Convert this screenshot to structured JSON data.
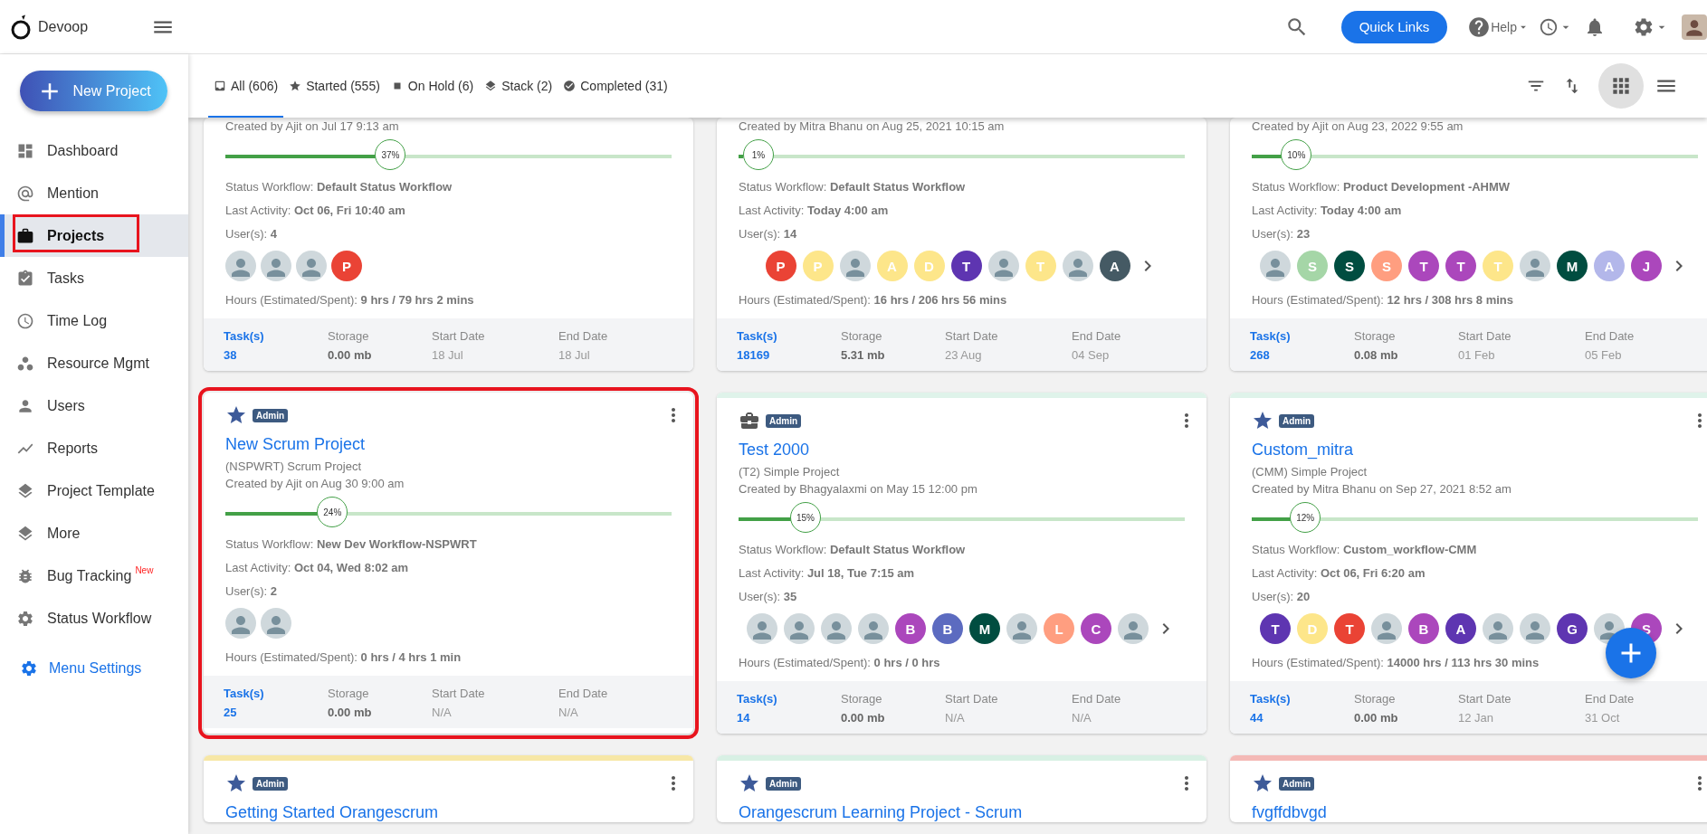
{
  "header": {
    "brand": "Devoop",
    "quick_links": "Quick Links",
    "help": "Help"
  },
  "sidebar": {
    "new_project": "New Project",
    "items": [
      {
        "label": "Dashboard",
        "selected": false
      },
      {
        "label": "Mention",
        "selected": false
      },
      {
        "label": "Projects",
        "selected": true,
        "highlighted": true
      },
      {
        "label": "Tasks",
        "selected": false
      },
      {
        "label": "Time Log",
        "selected": false
      },
      {
        "label": "Resource Mgmt",
        "selected": false
      },
      {
        "label": "Users",
        "selected": false
      },
      {
        "label": "Reports",
        "selected": false
      },
      {
        "label": "Project Template",
        "selected": false
      },
      {
        "label": "More",
        "selected": false
      },
      {
        "label": "Bug Tracking",
        "selected": false,
        "badge": "New"
      },
      {
        "label": "Status Workflow",
        "selected": false
      }
    ],
    "menu_settings": "Menu Settings"
  },
  "tabs": [
    {
      "label": "All (606)",
      "selected": true
    },
    {
      "label": "Started (555)",
      "selected": false
    },
    {
      "label": "On Hold (6)",
      "selected": false
    },
    {
      "label": "Stack (2)",
      "selected": false
    },
    {
      "label": "Completed (31)",
      "selected": false
    }
  ],
  "view_toggle": [
    {
      "kind": "grid",
      "selected": true
    },
    {
      "kind": "list",
      "selected": false
    }
  ],
  "cards": [
    {
      "created": "Created by Ajit on Jul 17 9:13 am",
      "progress": {
        "level": 0.37,
        "label": "37%"
      },
      "details": [
        {
          "label": "Status Workflow:",
          "value": "Default Status Workflow"
        },
        {
          "label": "Last Activity:",
          "value": "Oct 06, Fri 10:40 am"
        },
        {
          "label": "User(s):",
          "value": "4"
        }
      ],
      "users": [
        {
          "kind": "photo"
        },
        {
          "kind": "photo"
        },
        {
          "kind": "photo"
        },
        {
          "kind": "letter",
          "initial": "P",
          "color": "#ea4335"
        }
      ],
      "more_users": false,
      "hours": {
        "label": "Hours (Estimated/Spent):",
        "value": "9 hrs / 79 hrs 2 mins"
      },
      "stats": [
        {
          "kind": "link",
          "label": "Task(s)",
          "value": "38"
        },
        {
          "kind": "plain",
          "label": "Storage",
          "value": "0.00 mb"
        },
        {
          "kind": "muted",
          "label": "Start Date",
          "value": "18 Jul"
        },
        {
          "kind": "muted",
          "label": "End Date",
          "value": "18 Jul"
        }
      ]
    },
    {
      "created": "Created by Mitra Bhanu on Aug 25, 2021 10:15 am",
      "progress": {
        "level": 0.01,
        "label": "1%"
      },
      "details": [
        {
          "label": "Status Workflow:",
          "value": "Default Status Workflow"
        },
        {
          "label": "Last Activity:",
          "value": "Today 4:00 am"
        },
        {
          "label": "User(s):",
          "value": "14"
        }
      ],
      "users": [
        {
          "kind": "letter",
          "initial": "P",
          "color": "#ea4335"
        },
        {
          "kind": "letter",
          "initial": "P",
          "color": "#fde68a"
        },
        {
          "kind": "photo"
        },
        {
          "kind": "letter",
          "initial": "A",
          "color": "#fde68a"
        },
        {
          "kind": "letter",
          "initial": "D",
          "color": "#fde68a"
        },
        {
          "kind": "letter",
          "initial": "T",
          "color": "#5e35b1"
        },
        {
          "kind": "photo"
        },
        {
          "kind": "letter",
          "initial": "T",
          "color": "#fde68a"
        },
        {
          "kind": "photo"
        },
        {
          "kind": "letter",
          "initial": "A",
          "color": "#455a64"
        }
      ],
      "more_users": true,
      "hours": {
        "label": "Hours (Estimated/Spent):",
        "value": "16 hrs / 206 hrs 56 mins"
      },
      "stats": [
        {
          "kind": "link",
          "label": "Task(s)",
          "value": "18169"
        },
        {
          "kind": "plain",
          "label": "Storage",
          "value": "5.31 mb"
        },
        {
          "kind": "muted",
          "label": "Start Date",
          "value": "23 Aug"
        },
        {
          "kind": "muted",
          "label": "End Date",
          "value": "04 Sep"
        }
      ]
    },
    {
      "created": "Created by Ajit on Aug 23, 2022 9:55 am",
      "progress": {
        "level": 0.1,
        "label": "10%"
      },
      "details": [
        {
          "label": "Status Workflow:",
          "value": "Product Development -AHMW"
        },
        {
          "label": "Last Activity:",
          "value": "Today 4:00 am"
        },
        {
          "label": "User(s):",
          "value": "23"
        }
      ],
      "users": [
        {
          "kind": "photo"
        },
        {
          "kind": "letter",
          "initial": "S",
          "color": "#a5d6a7"
        },
        {
          "kind": "letter",
          "initial": "S",
          "color": "#004d40"
        },
        {
          "kind": "letter",
          "initial": "S",
          "color": "#ff9e80"
        },
        {
          "kind": "letter",
          "initial": "T",
          "color": "#ab47bc"
        },
        {
          "kind": "letter",
          "initial": "T",
          "color": "#ab47bc"
        },
        {
          "kind": "letter",
          "initial": "T",
          "color": "#fde68a"
        },
        {
          "kind": "photo"
        },
        {
          "kind": "letter",
          "initial": "M",
          "color": "#004d40"
        },
        {
          "kind": "letter",
          "initial": "A",
          "color": "#b3b7ea"
        },
        {
          "kind": "letter",
          "initial": "J",
          "color": "#ab47bc"
        }
      ],
      "more_users": true,
      "hours": {
        "label": "Hours (Estimated/Spent):",
        "value": "12 hrs / 308 hrs 8 mins"
      },
      "stats": [
        {
          "kind": "link",
          "label": "Task(s)",
          "value": "268"
        },
        {
          "kind": "plain",
          "label": "Storage",
          "value": "0.08 mb"
        },
        {
          "kind": "muted",
          "label": "Start Date",
          "value": "01 Feb"
        },
        {
          "kind": "muted",
          "label": "End Date",
          "value": "05 Feb"
        }
      ]
    },
    {
      "starred": true,
      "badge": "Admin",
      "highlighted": true,
      "title": "New Scrum Project",
      "subtitle": "(NSPWRT) Scrum Project",
      "created": "Created by Ajit on Aug 30 9:00 am",
      "progress": {
        "level": 0.24,
        "label": "24%"
      },
      "details": [
        {
          "label": "Status Workflow:",
          "value": "New Dev Workflow-NSPWRT"
        },
        {
          "label": "Last Activity:",
          "value": "Oct 04, Wed 8:02 am"
        },
        {
          "label": "User(s):",
          "value": "2"
        }
      ],
      "users": [
        {
          "kind": "photo"
        },
        {
          "kind": "photo"
        }
      ],
      "more_users": false,
      "hours": {
        "label": "Hours (Estimated/Spent):",
        "value": "0 hrs / 4 hrs 1 min"
      },
      "stats": [
        {
          "kind": "link",
          "label": "Task(s)",
          "value": "25"
        },
        {
          "kind": "plain",
          "label": "Storage",
          "value": "0.00 mb"
        },
        {
          "kind": "muted",
          "label": "Start Date",
          "value": "N/A"
        },
        {
          "kind": "muted",
          "label": "End Date",
          "value": "N/A"
        }
      ]
    },
    {
      "starred": false,
      "badge": "Admin",
      "color": "#dff3ea",
      "title": "Test 2000",
      "subtitle": "(T2) Simple Project",
      "created": "Created by Bhagyalaxmi on May 15 12:00 pm",
      "progress": {
        "level": 0.15,
        "label": "15%"
      },
      "details": [
        {
          "label": "Status Workflow:",
          "value": "Default Status Workflow"
        },
        {
          "label": "Last Activity:",
          "value": "Jul 18, Tue 7:15 am"
        },
        {
          "label": "User(s):",
          "value": "35"
        }
      ],
      "users": [
        {
          "kind": "photo"
        },
        {
          "kind": "photo"
        },
        {
          "kind": "photo"
        },
        {
          "kind": "photo"
        },
        {
          "kind": "letter",
          "initial": "B",
          "color": "#ab47bc"
        },
        {
          "kind": "letter",
          "initial": "B",
          "color": "#5c6bc0"
        },
        {
          "kind": "letter",
          "initial": "M",
          "color": "#004d40"
        },
        {
          "kind": "photo"
        },
        {
          "kind": "letter",
          "initial": "L",
          "color": "#ff9e80"
        },
        {
          "kind": "letter",
          "initial": "C",
          "color": "#ab47bc"
        },
        {
          "kind": "photo"
        }
      ],
      "more_users": true,
      "hours": {
        "label": "Hours (Estimated/Spent):",
        "value": "0 hrs / 0 hrs"
      },
      "stats": [
        {
          "kind": "link",
          "label": "Task(s)",
          "value": "14"
        },
        {
          "kind": "plain",
          "label": "Storage",
          "value": "0.00 mb"
        },
        {
          "kind": "muted",
          "label": "Start Date",
          "value": "N/A"
        },
        {
          "kind": "muted",
          "label": "End Date",
          "value": "N/A"
        }
      ]
    },
    {
      "starred": true,
      "badge": "Admin",
      "color": "#dff3ea",
      "title": "Custom_mitra",
      "subtitle": "(CMM) Simple Project",
      "created": "Created by Mitra Bhanu on Sep 27, 2021 8:52 am",
      "progress": {
        "level": 0.12,
        "label": "12%"
      },
      "details": [
        {
          "label": "Status Workflow:",
          "value": "Custom_workflow-CMM"
        },
        {
          "label": "Last Activity:",
          "value": "Oct 06, Fri 6:20 am"
        },
        {
          "label": "User(s):",
          "value": "20"
        }
      ],
      "users": [
        {
          "kind": "letter",
          "initial": "T",
          "color": "#5e35b1"
        },
        {
          "kind": "letter",
          "initial": "D",
          "color": "#fde68a"
        },
        {
          "kind": "letter",
          "initial": "T",
          "color": "#ea4335"
        },
        {
          "kind": "photo"
        },
        {
          "kind": "letter",
          "initial": "B",
          "color": "#ab47bc"
        },
        {
          "kind": "letter",
          "initial": "A",
          "color": "#5e35b1"
        },
        {
          "kind": "photo"
        },
        {
          "kind": "photo"
        },
        {
          "kind": "letter",
          "initial": "G",
          "color": "#5e35b1"
        },
        {
          "kind": "photo"
        },
        {
          "kind": "letter",
          "initial": "S",
          "color": "#ab47bc"
        }
      ],
      "more_users": true,
      "hours": {
        "label": "Hours (Estimated/Spent):",
        "value": "14000 hrs / 113 hrs 30 mins"
      },
      "stats": [
        {
          "kind": "link",
          "label": "Task(s)",
          "value": "44"
        },
        {
          "kind": "plain",
          "label": "Storage",
          "value": "0.00 mb"
        },
        {
          "kind": "muted",
          "label": "Start Date",
          "value": "12 Jan"
        },
        {
          "kind": "muted",
          "label": "End Date",
          "value": "31 Oct"
        }
      ]
    },
    {
      "starred": true,
      "badge": "Admin",
      "color": "#f7e7a6",
      "title": "Getting Started Orangescrum"
    },
    {
      "starred": true,
      "badge": "Admin",
      "color": "#d8f0e4",
      "title": "Orangescrum Learning Project - Scrum"
    },
    {
      "starred": true,
      "badge": "Admin",
      "color": "#f4b9b6",
      "title": "fvgffdbvgd"
    }
  ]
}
